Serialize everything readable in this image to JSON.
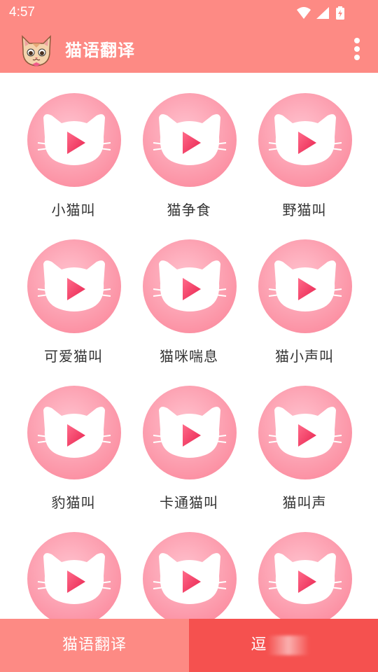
{
  "status_bar": {
    "time": "4:57"
  },
  "app_bar": {
    "title": "猫语翻译",
    "colors": {
      "background": "#fd8a84"
    }
  },
  "sounds": [
    {
      "label": "小猫叫"
    },
    {
      "label": "猫争食"
    },
    {
      "label": "野猫叫"
    },
    {
      "label": "可爱猫叫"
    },
    {
      "label": "猫咪喘息"
    },
    {
      "label": "猫小声叫"
    },
    {
      "label": "豹猫叫"
    },
    {
      "label": "卡通猫叫"
    },
    {
      "label": "猫叫声"
    },
    {
      "label": ""
    },
    {
      "label": ""
    },
    {
      "label": ""
    }
  ],
  "bottom_nav": {
    "tabs": [
      {
        "label": "猫语翻译",
        "color": "#fd8a84"
      },
      {
        "label": "逗",
        "color": "#f5514f"
      }
    ]
  },
  "icons": {
    "tile": "cat-head-play-icon",
    "menu": "more-vert-icon",
    "logo": "cat-logo-icon"
  }
}
